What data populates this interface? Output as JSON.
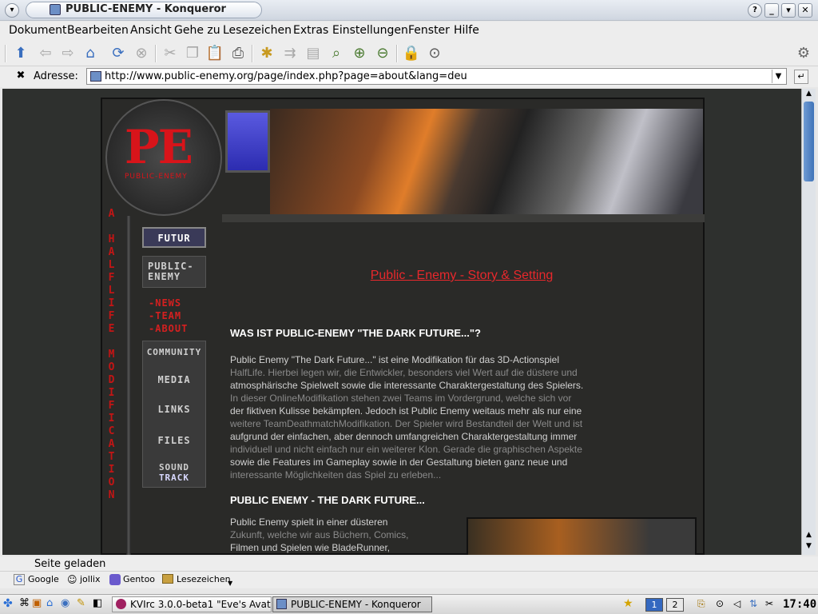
{
  "window": {
    "title": "PUBLIC-ENEMY - Konqueror"
  },
  "menubar": [
    "Dokument",
    "Bearbeiten",
    "Ansicht",
    "Gehe zu",
    "Lesezeichen",
    "Extras",
    "Einstellungen",
    "Fenster",
    "Hilfe"
  ],
  "location": {
    "label": "Adresse:",
    "url": "http://www.public-enemy.org/page/index.php?page=about&lang=deu"
  },
  "site": {
    "logo_text": "PE",
    "logo_sub": "PUBLIC-ENEMY",
    "vertical_text": "A HALFLIFE MODIFICATION",
    "nav": {
      "futur": "FUTUR",
      "public_enemy": "PUBLIC-ENEMY",
      "news": "-NEWS",
      "team": "-TEAM",
      "about": "-ABOUT",
      "community": "COMMUNITY",
      "media": "MEDIA",
      "links": "LINKS",
      "files": "FILES",
      "sound": "SOUND",
      "track": "TRACK"
    },
    "heading": "Public - Enemy - Story & Setting",
    "section1_title": "WAS IST PUBLIC-ENEMY \"THE DARK FUTURE...\"?",
    "section1_lines": [
      "Public Enemy \"The Dark Future...\" ist eine Modifikation für das 3D-Actionspiel",
      "HalfLife. Hierbei legen wir, die Entwickler, besonders viel Wert auf die düstere und",
      "atmosphärische Spielwelt sowie die interessante Charaktergestaltung des Spielers.",
      "In dieser OnlineModifikation stehen zwei Teams im Vordergrund, welche sich vor",
      "der fiktiven Kulisse bekämpfen. Jedoch ist Public Enemy weitaus mehr als nur eine",
      "weitere TeamDeathmatchModifikation. Der Spieler wird Bestandteil der Welt und ist",
      "aufgrund der einfachen, aber dennoch umfangreichen Charaktergestaltung immer",
      "individuell und nicht einfach nur ein weiterer Klon. Gerade die graphischen Aspekte",
      "sowie die Features im Gameplay sowie in der Gestaltung bieten ganz neue und",
      "interessante Möglichkeiten das Spiel zu erleben..."
    ],
    "section2_title": "PUBLIC ENEMY - THE DARK FUTURE...",
    "section2_lines": [
      "Public Enemy spielt in einer düsteren",
      "Zukunft, welche wir aus Büchern, Comics,",
      "Filmen und Spielen wie BladeRunner,"
    ]
  },
  "status": {
    "text": "Seite geladen"
  },
  "bookmarks": [
    "Google",
    "jollix",
    "Gentoo",
    "Lesezeichen"
  ],
  "taskbar": {
    "tasks": [
      "KVIrc 3.0.0-beta1 \"Eve's Avat",
      "PUBLIC-ENEMY - Konqueror"
    ],
    "desktops": [
      "1",
      "2"
    ],
    "clock": "17:40"
  }
}
